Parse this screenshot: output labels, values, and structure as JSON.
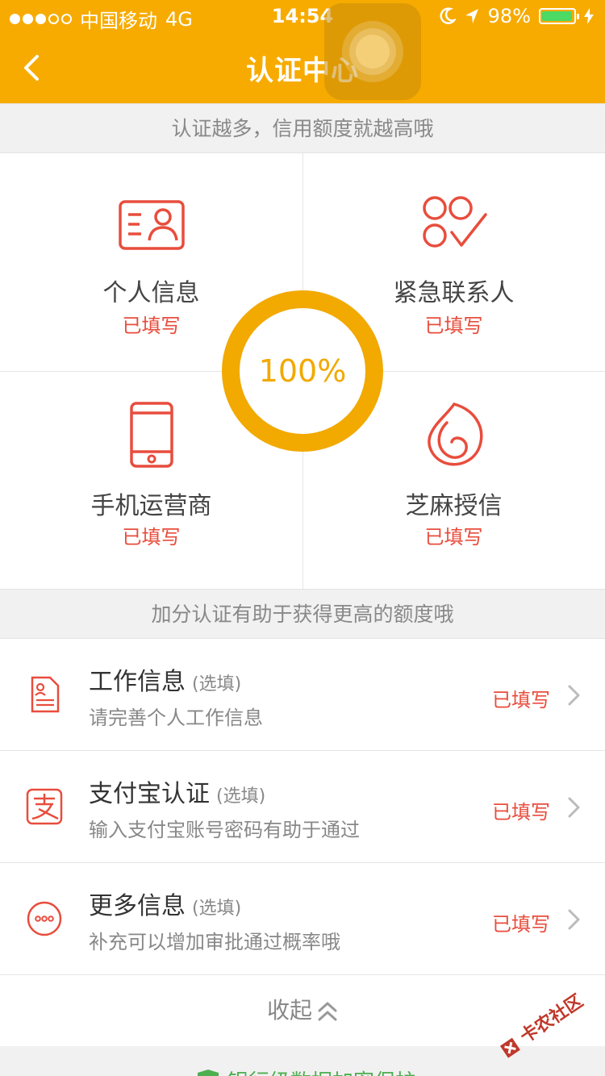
{
  "statusbar": {
    "carrier": "中国移动",
    "network": "4G",
    "time": "14:54",
    "battery": "98%",
    "battery_level": 0.98
  },
  "navbar": {
    "title": "认证中心"
  },
  "banner_top": "认证越多，信用额度就越高哦",
  "grid": {
    "items": [
      {
        "label": "个人信息",
        "status": "已填写",
        "icon": "id-card-icon"
      },
      {
        "label": "紧急联系人",
        "status": "已填写",
        "icon": "contacts-check-icon"
      },
      {
        "label": "手机运营商",
        "status": "已填写",
        "icon": "phone-icon"
      },
      {
        "label": "芝麻授信",
        "status": "已填写",
        "icon": "sesame-credit-icon"
      }
    ],
    "progress_text": "100%",
    "progress_value": 1.0
  },
  "banner_bottom": "加分认证有助于获得更高的额度哦",
  "list": {
    "items": [
      {
        "title": "工作信息",
        "optional": "(选填)",
        "desc": "请完善个人工作信息",
        "status": "已填写",
        "icon": "document-icon"
      },
      {
        "title": "支付宝认证",
        "optional": "(选填)",
        "desc": "输入支付宝账号密码有助于通过",
        "status": "已填写",
        "icon": "alipay-icon"
      },
      {
        "title": "更多信息",
        "optional": "(选填)",
        "desc": "补充可以增加审批通过概率哦",
        "status": "已填写",
        "icon": "more-icon"
      }
    ]
  },
  "collapse_label": "收起",
  "footer_text": "银行级数据加密保护",
  "watermark": "卡农社区",
  "colors": {
    "brand": "#f7ab00",
    "accent_red": "#e84d3d",
    "progress": "#f2a900",
    "secure_green": "#4caf50"
  }
}
